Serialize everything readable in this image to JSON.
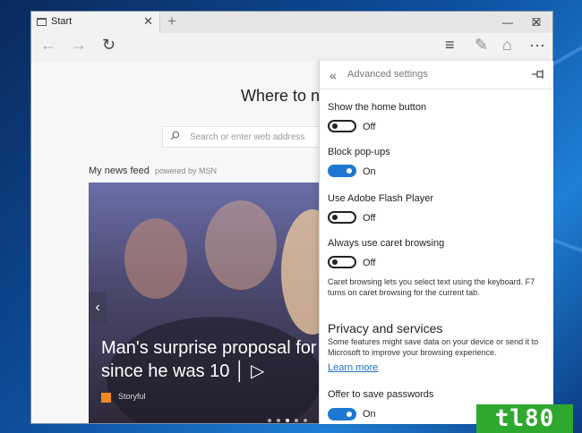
{
  "tab": {
    "title": "Start",
    "close": "✕",
    "new_tab": "+"
  },
  "window_controls": {
    "minimize": "—",
    "maximize": "☐",
    "close": "✕"
  },
  "toolbar": {
    "back": "←",
    "forward": "→",
    "refresh": "↻",
    "hub": "≡",
    "note": "✎",
    "share": "⌂",
    "more": "···"
  },
  "start_page": {
    "headline": "Where to ne",
    "search_placeholder": "Search or enter web address",
    "feed_title": "My news feed",
    "feed_powered": "powered by MSN",
    "hero_line1": "Man's surprise proposal for",
    "hero_line2": "since he was 10 │ ▷",
    "source": "Storyful",
    "prev_arrow": "‹"
  },
  "panel": {
    "back": "«",
    "title": "Advanced settings",
    "settings": [
      {
        "label": "Show the home button",
        "state": "Off",
        "on": false
      },
      {
        "label": "Block pop-ups",
        "state": "On",
        "on": true
      },
      {
        "label": "Use Adobe Flash Player",
        "state": "Off",
        "on": false
      },
      {
        "label": "Always use caret browsing",
        "state": "Off",
        "on": false
      }
    ],
    "caret_note": "Caret browsing lets you select text using the keyboard. F7 turns on caret browsing for the current tab.",
    "privacy_title": "Privacy and services",
    "privacy_note": "Some features might save data on your device or send it to Microsoft to improve your browsing experience.",
    "learn_more": "Learn more",
    "save_passwords": {
      "label": "Offer to save passwords",
      "state": "On",
      "on": true
    }
  },
  "watermark": "tl80",
  "colors": {
    "accent": "#1e78d2",
    "link": "#1e6fc8",
    "logo": "#2fa82f"
  }
}
